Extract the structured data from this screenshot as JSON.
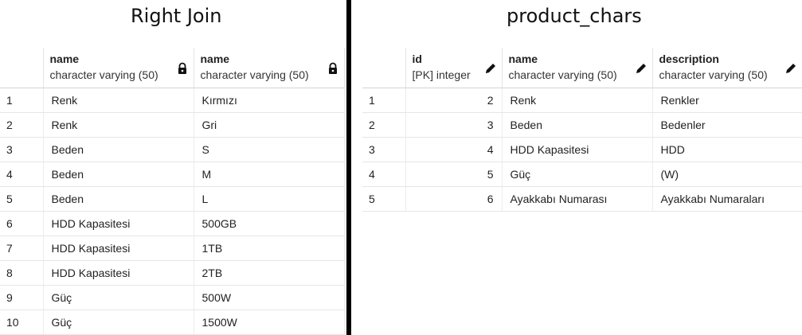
{
  "left_panel": {
    "title": "Right Join",
    "columns": [
      {
        "name": "name",
        "type": "character varying (50)",
        "icon": "lock-icon"
      },
      {
        "name": "name",
        "type": "character varying (50)",
        "icon": "lock-icon"
      }
    ],
    "rows": [
      {
        "n": "1",
        "c1": "Renk",
        "c2": "Kırmızı"
      },
      {
        "n": "2",
        "c1": "Renk",
        "c2": "Gri"
      },
      {
        "n": "3",
        "c1": "Beden",
        "c2": "S"
      },
      {
        "n": "4",
        "c1": "Beden",
        "c2": "M"
      },
      {
        "n": "5",
        "c1": "Beden",
        "c2": "L"
      },
      {
        "n": "6",
        "c1": "HDD Kapasitesi",
        "c2": "500GB"
      },
      {
        "n": "7",
        "c1": "HDD Kapasitesi",
        "c2": "1TB"
      },
      {
        "n": "8",
        "c1": "HDD Kapasitesi",
        "c2": "2TB"
      },
      {
        "n": "9",
        "c1": "Güç",
        "c2": "500W"
      },
      {
        "n": "10",
        "c1": "Güç",
        "c2": "1500W"
      }
    ]
  },
  "right_panel": {
    "title": "product_chars",
    "columns": [
      {
        "name": "id",
        "type": "[PK] integer",
        "icon": "pencil-icon"
      },
      {
        "name": "name",
        "type": "character varying (50)",
        "icon": "pencil-icon"
      },
      {
        "name": "description",
        "type": "character varying (50)",
        "icon": "pencil-icon"
      }
    ],
    "rows": [
      {
        "n": "1",
        "id": "2",
        "name": "Renk",
        "desc": "Renkler"
      },
      {
        "n": "2",
        "id": "3",
        "name": "Beden",
        "desc": "Bedenler"
      },
      {
        "n": "3",
        "id": "4",
        "name": "HDD Kapasitesi",
        "desc": "HDD"
      },
      {
        "n": "4",
        "id": "5",
        "name": "Güç",
        "desc": "(W)"
      },
      {
        "n": "5",
        "id": "6",
        "name": "Ayakkabı Numarası",
        "desc": "Ayakkabı Numaraları"
      }
    ]
  }
}
